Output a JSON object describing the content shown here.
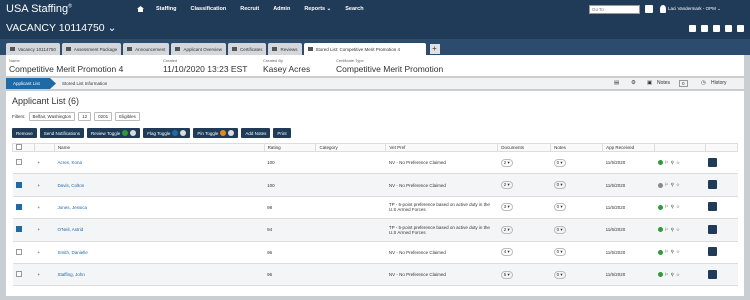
{
  "app": {
    "brand": "USA Staffing",
    "brand_mark": "®"
  },
  "nav": [
    "Staffing",
    "Classification",
    "Recruit",
    "Admin",
    "Reports ⌄",
    "Search"
  ],
  "goto_placeholder": "Go To",
  "user": "Laci Vandermark - OPM ⌄",
  "vacancy": "VACANCY 10114750 ⌄",
  "tabs": [
    "Vacancy 10114750",
    "Assessment Package",
    "Announcement",
    "Applicant Overview",
    "Certificates",
    "Reviews",
    "Stored List: Competitive Merit Promotion 4"
  ],
  "tab_add": "+",
  "header": {
    "name_label": "Name",
    "name": "Competitive Merit Promotion 4",
    "created_label": "Created",
    "created": "11/10/2020 13:23 EST",
    "createdby_label": "Created By",
    "createdby": "Kasey Acres",
    "certtype_label": "Certificate Type",
    "certtype": "Competitive Merit Promotion"
  },
  "crumbs": {
    "active": "Applicant List",
    "next": "Stored List Information"
  },
  "right_tools": {
    "notes_label": "Notes",
    "notes_count": "0",
    "history_label": "History"
  },
  "title": "Applicant List (6)",
  "filters": {
    "label": "Filters:",
    "chips": [
      "Belfair, Washington",
      "12",
      "0201",
      "Eligibles"
    ]
  },
  "actions": [
    "Remove",
    "Send Notifications",
    "Review Toggle",
    "Flag Toggle",
    "Pin Toggle",
    "Add Notes",
    "Print"
  ],
  "columns": [
    "",
    "",
    "Name",
    "Rating",
    "Category",
    "Vet Pref",
    "Documents",
    "Notes",
    "App Received",
    "",
    ""
  ],
  "rows": [
    {
      "checked": false,
      "name": "Acres, Kona",
      "rating": "100",
      "vet": "NV - No Preference Claimed",
      "docs": "2",
      "notes": "0",
      "recv": "11/5/2020",
      "review": "#2e9a3c"
    },
    {
      "checked": true,
      "name": "Davis, Colton",
      "rating": "100",
      "vet": "NV - No Preference Claimed",
      "docs": "2",
      "notes": "0",
      "recv": "11/5/2020",
      "review": "#888888"
    },
    {
      "checked": true,
      "name": "Jones, Jessica",
      "rating": "98",
      "vet": "TP - 5-point preference based on active duty in the U.S Armed Forces",
      "docs": "3",
      "notes": "0",
      "recv": "11/5/2020",
      "review": "#2e9a3c"
    },
    {
      "checked": true,
      "name": "O'Neil, Astrid",
      "rating": "94",
      "vet": "TP - 5-point preference based on active duty in the U.S Armed Forces",
      "docs": "2",
      "notes": "0",
      "recv": "11/6/2020",
      "review": "#2e9a3c"
    },
    {
      "checked": false,
      "name": "Smith, Danielle",
      "rating": "96",
      "vet": "NV - No Preference Claimed",
      "docs": "4",
      "notes": "0",
      "recv": "11/5/2020",
      "review": "#2e9a3c"
    },
    {
      "checked": false,
      "name": "Staffing, John",
      "rating": "96",
      "vet": "NV - No Preference Claimed",
      "docs": "5",
      "notes": "0",
      "recv": "11/5/2020",
      "review": "#2e9a3c"
    }
  ]
}
